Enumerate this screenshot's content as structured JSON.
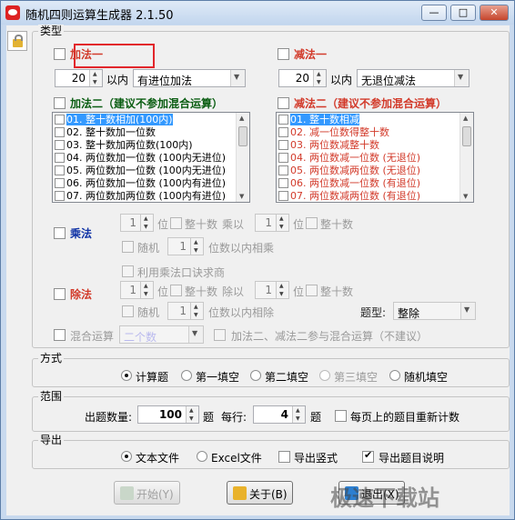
{
  "window": {
    "title": "随机四则运算生成器 2.1.50",
    "min_glyph": "—",
    "max_glyph": "□",
    "close_glyph": "✕"
  },
  "type_group": {
    "title": "类型",
    "add1": {
      "label": "加法一",
      "checked": false,
      "limit": "20",
      "unit": "以内",
      "mode": "有进位加法"
    },
    "sub1": {
      "label": "减法一",
      "checked": false,
      "limit": "20",
      "unit": "以内",
      "mode": "无退位减法"
    },
    "add2": {
      "label": "加法二（建议不参加混合运算）",
      "items": [
        "01. 整十数相加(100内)",
        "02. 整十数加一位数",
        "03. 整十数加两位数(100内)",
        "04. 两位数加一位数 (100内无进位)",
        "05. 两位数加一位数 (100内无进位)",
        "06. 两位数加一位数 (100内有进位)",
        "07. 两位数加两位数 (100内有进位)"
      ]
    },
    "sub2": {
      "label": "减法二（建议不参加混合运算）",
      "items": [
        "01. 整十数相减",
        "02. 减一位数得整十数",
        "03. 两位数减整十数",
        "04. 两位数减一位数 (无退位)",
        "05. 两位数减两位数 (无退位)",
        "06. 两位数减一位数 (有退位)",
        "07. 两位数减两位数 (有退位)"
      ]
    },
    "mul": {
      "label": "乘法",
      "digits_a": "1",
      "digits_b": "1",
      "random_digits": "1",
      "wei": "位",
      "whole_ten": "整十数",
      "times": "乘以",
      "random": "随机",
      "within": "位数以内相乘"
    },
    "div": {
      "label": "除法",
      "use_mul_table": "利用乘法口诀求商",
      "digits_a": "1",
      "digits_b": "1",
      "random_digits": "1",
      "wei": "位",
      "whole_ten": "整十数",
      "divide": "除以",
      "random": "随机",
      "within": "位数以内相除",
      "type_label": "题型:",
      "type_value": "整除"
    },
    "mixed": {
      "label": "混合运算",
      "count": "二个数",
      "note": "加法二、减法二参与混合运算（不建议）"
    }
  },
  "method_group": {
    "title": "方式",
    "options": [
      "计算题",
      "第一填空",
      "第二填空",
      "第三填空",
      "随机填空"
    ],
    "selected": "计算题"
  },
  "range_group": {
    "title": "范围",
    "count_label": "出题数量:",
    "count": "100",
    "unit1": "题",
    "per_row_label": "每行:",
    "per_row": "4",
    "unit2": "题",
    "reshuffle_label": "每页上的题目重新计数"
  },
  "export_group": {
    "title": "导出",
    "options": [
      "文本文件",
      "Excel文件"
    ],
    "selected": "文本文件",
    "vertical_label": "导出竖式",
    "vertical_checked": false,
    "desc_label": "导出题目说明",
    "desc_checked": true
  },
  "buttons": {
    "start": "开始(Y)",
    "about": "关于(B)",
    "exit": "退出(X)"
  },
  "watermark": "极速下载站",
  "colors": {
    "accent_red": "#d23a2a",
    "accent_green": "#0a5d12",
    "accent_blue": "#1134a6",
    "selection": "#3399ff"
  }
}
